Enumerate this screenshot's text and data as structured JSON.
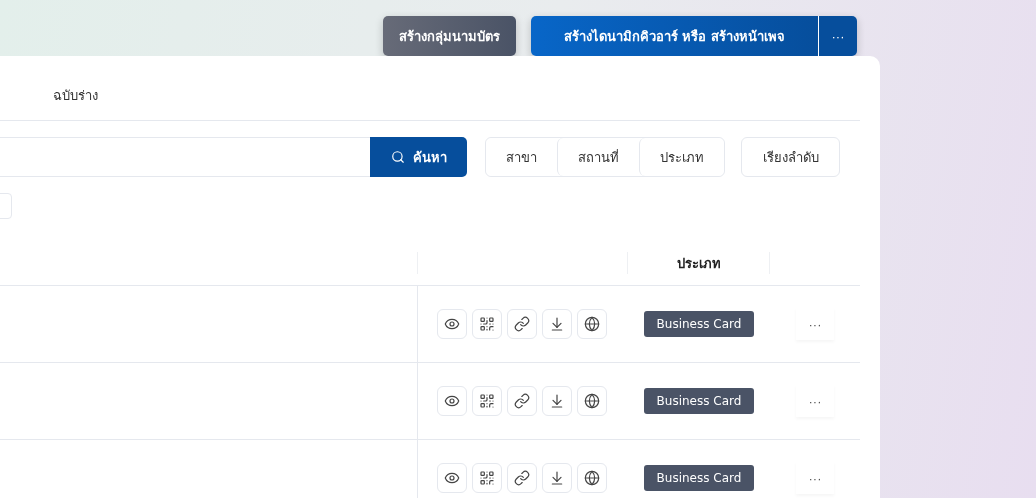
{
  "header_buttons": {
    "secondary": "สร้างกลุ่มนามบัตร",
    "primary": "สร้างไดนามิกคิวอาร์ หรือ สร้างหน้าเพจ",
    "more": "···"
  },
  "tabs": [
    {
      "label": "ฉบับร่าง",
      "selected": false
    }
  ],
  "search": {
    "button": "ค้นหา"
  },
  "filters": [
    "สาขา",
    "สถานที่",
    "ประเภท"
  ],
  "sort_button": "เรียงลำดับ",
  "table": {
    "type_heading": "ประเภท",
    "rows": [
      {
        "type": "Business Card",
        "more": "···"
      },
      {
        "type": "Business Card",
        "more": "···"
      },
      {
        "type": "Business Card",
        "more": "···"
      }
    ]
  }
}
